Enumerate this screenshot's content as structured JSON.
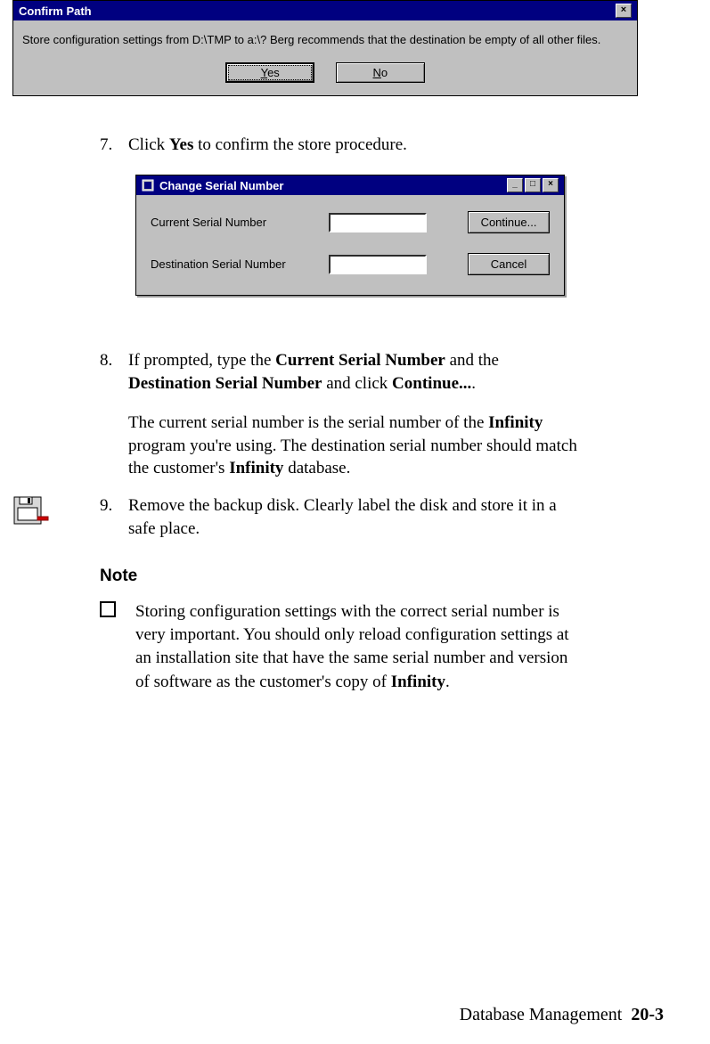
{
  "dialog1": {
    "title": "Confirm Path",
    "message": "Store configuration settings from D:\\TMP to a:\\? Berg recommends that the destination be empty of all other files.",
    "yes_prefix": "Y",
    "yes_rest": "es",
    "no_prefix": "N",
    "no_rest": "o",
    "close_glyph": "×"
  },
  "dialog2": {
    "title": "Change Serial Number",
    "label_current": "Current Serial Number",
    "label_dest": "Destination Serial Number",
    "btn_continue": "Continue...",
    "btn_cancel": "Cancel",
    "min_glyph": "_",
    "max_glyph": "□",
    "close_glyph": "×"
  },
  "steps": {
    "s7_num": "7.",
    "s7_a": "Click ",
    "s7_b": "Yes",
    "s7_c": " to confirm the store procedure.",
    "s8_num": "8.",
    "s8_a": "If prompted, type the ",
    "s8_b": "Current Serial Number",
    "s8_c": " and the ",
    "s8_d": "Destination Serial Number",
    "s8_e": " and click ",
    "s8_f": "Continue...",
    "s8_g": ".",
    "s8b_a": "The current serial number is the serial number of the ",
    "s8b_b": "Infinity",
    "s8b_c": " program you're using. The destination serial number should match the customer's ",
    "s8b_d": "Infinity",
    "s8b_e": " database.",
    "s9_num": "9.",
    "s9_a": "Remove the backup disk. Clearly label the disk and store it in a safe place."
  },
  "note": {
    "heading": "Note",
    "a": "Storing configuration settings with the correct serial number is very important. You should only reload configuration settings at an installation site that have the same serial number and version of software as the customer's copy of ",
    "b": "Infinity",
    "c": "."
  },
  "footer": {
    "label": "Database Management",
    "page": "20-3"
  }
}
